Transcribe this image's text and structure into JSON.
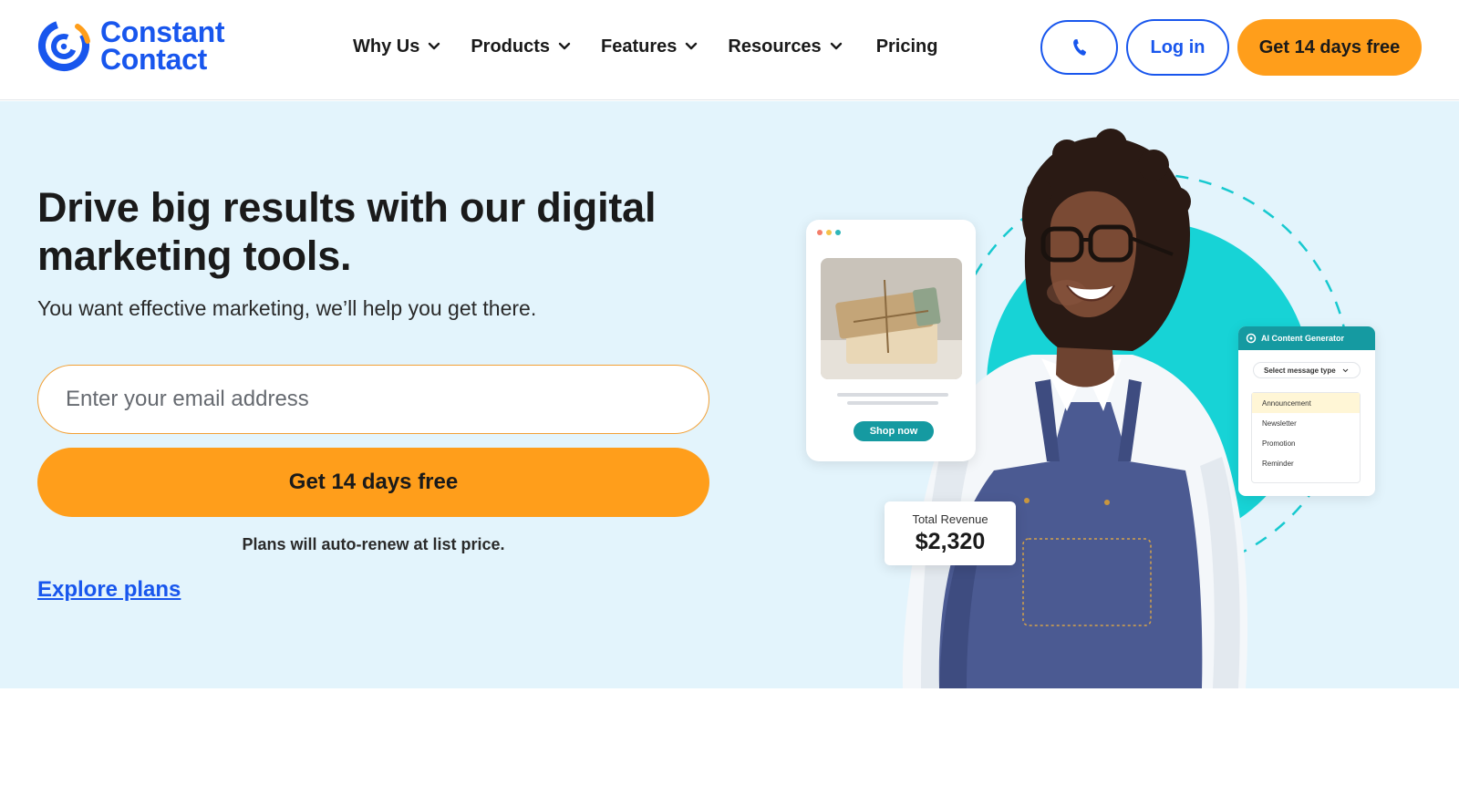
{
  "brand": {
    "name_line1": "Constant",
    "name_line2": "Contact",
    "primary_color": "#1856ED",
    "accent_color": "#FF9E1B",
    "hero_bg": "#E3F4FC",
    "teal": "#17D3D6"
  },
  "nav": {
    "items": [
      {
        "label": "Why Us",
        "has_dropdown": true
      },
      {
        "label": "Products",
        "has_dropdown": true
      },
      {
        "label": "Features",
        "has_dropdown": true
      },
      {
        "label": "Resources",
        "has_dropdown": true
      }
    ],
    "pricing_label": "Pricing",
    "phone_icon": "phone-icon",
    "login_label": "Log in",
    "cta_label": "Get 14 days free"
  },
  "hero": {
    "headline": "Drive big results with our digital marketing tools.",
    "subhead": "You want effective marketing, we’ll help you get there.",
    "email_placeholder": "Enter your email address",
    "cta_label": "Get 14 days free",
    "renew_note": "Plans will auto-renew at list price.",
    "explore_link": "Explore plans"
  },
  "illustration": {
    "shop_button": "Shop now",
    "ai_card": {
      "title": "AI Content Generator",
      "select_label": "Select message type",
      "options": [
        "Announcement",
        "Newsletter",
        "Promotion",
        "Reminder"
      ]
    },
    "revenue": {
      "label": "Total Revenue",
      "value": "$2,320"
    }
  }
}
